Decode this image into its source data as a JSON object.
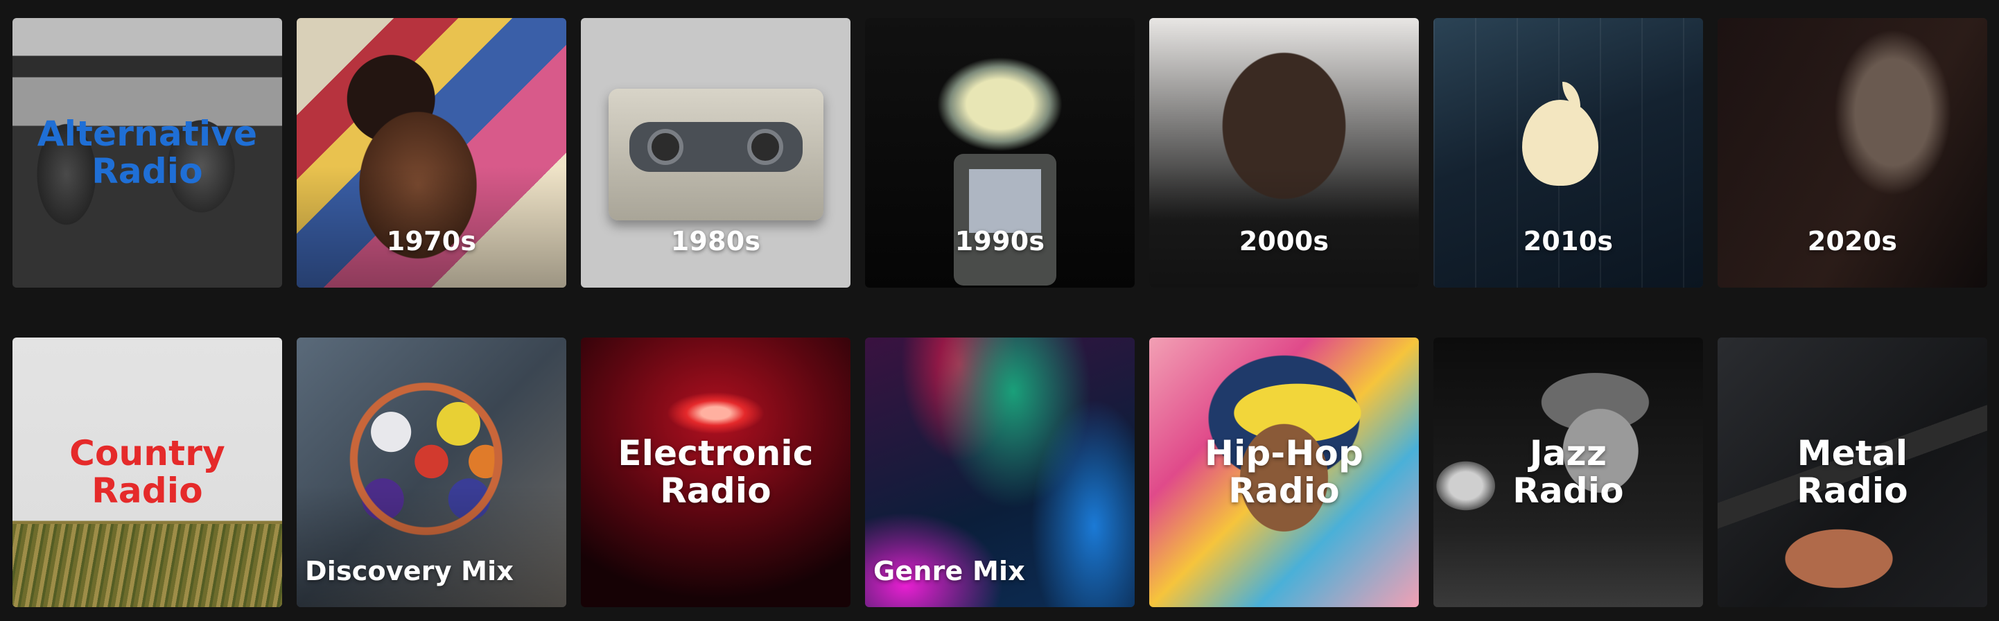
{
  "tiles": [
    {
      "id": "alternative-radio",
      "label": "Alternative\nRadio",
      "label_color": "#1f6fd6"
    },
    {
      "id": "1970s",
      "label": "1970s"
    },
    {
      "id": "1980s",
      "label": "1980s"
    },
    {
      "id": "1990s",
      "label": "1990s"
    },
    {
      "id": "2000s",
      "label": "2000s"
    },
    {
      "id": "2010s",
      "label": "2010s"
    },
    {
      "id": "2020s",
      "label": "2020s"
    },
    {
      "id": "country-radio",
      "label": "Country\nRadio",
      "label_color": "#e52a2a"
    },
    {
      "id": "discovery-mix",
      "label": "Discovery Mix"
    },
    {
      "id": "electronic-radio",
      "label": "Electronic\nRadio"
    },
    {
      "id": "genre-mix",
      "label": "Genre Mix"
    },
    {
      "id": "hip-hop-radio",
      "label": "Hip-Hop\nRadio"
    },
    {
      "id": "jazz-radio",
      "label": "Jazz\nRadio"
    },
    {
      "id": "metal-radio",
      "label": "Metal\nRadio"
    }
  ],
  "colors": {
    "background": "#141414",
    "tile_text": "#ffffff"
  }
}
